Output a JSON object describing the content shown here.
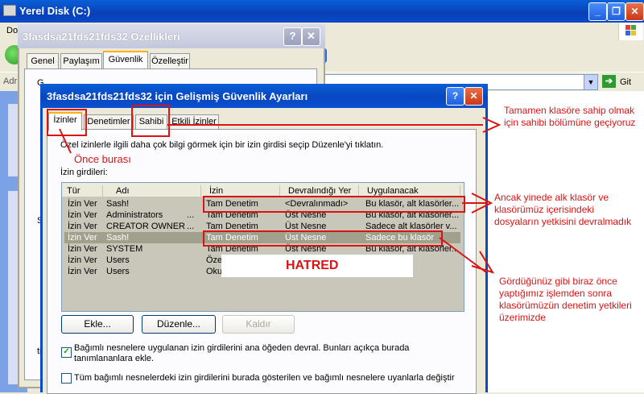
{
  "explorer": {
    "title": "Yerel Disk (C:)",
    "menu_first": "Do",
    "addr_label": "Adr",
    "go_label": "Git",
    "colors": {
      "titlebar": "#0a4ac8",
      "leftpane": "#7ba2e7"
    }
  },
  "props_dialog": {
    "title": "3fasdsa21fds21fds32 Özellikleri",
    "tabs": [
      "Genel",
      "Paylaşım",
      "Güvenlik",
      "Özelleştir"
    ],
    "active_tab": "Güvenlik",
    "partial_text_a": "G",
    "partial_text_b": "S",
    "partial_text_c": "ti"
  },
  "adv_dialog": {
    "title": "3fasdsa21fds21fds32 için Gelişmiş Güvenlik Ayarları",
    "tabs": [
      "İzinler",
      "Denetimler",
      "Sahibi",
      "Etkili İzinler"
    ],
    "active_tab": "İzinler",
    "info_text": "Özel izinlerle ilgili daha çok bilgi görmek için bir izin girdisi seçip Düzenle'yi tıklatın.",
    "entries_label": "İzin girdileri:",
    "columns": [
      "Tür",
      "Adı",
      "İzin",
      "Devralındığı Yer",
      "Uygulanacak"
    ],
    "rows": [
      {
        "type": "İzin Ver",
        "name": "Sash!",
        "perm": "Tam Denetim",
        "from": "<Devralınmadı>",
        "apply": "Bu klasör, alt klasörler..."
      },
      {
        "type": "İzin Ver",
        "name": "Administrators",
        "perm": "Tam Denetim",
        "from": "Üst Nesne",
        "apply": "Bu klasör, alt klasörler..."
      },
      {
        "type": "İzin Ver",
        "name": "CREATOR OWNER",
        "perm": "Tam Denetim",
        "from": "Üst Nesne",
        "apply": "Sadece alt klasörler v..."
      },
      {
        "type": "İzin Ver",
        "name": "Sash!",
        "perm": "Tam Denetim",
        "from": "Üst Nesne",
        "apply": "Sadece bu klasör"
      },
      {
        "type": "İzin Ver",
        "name": "SYSTEM",
        "perm": "Tam Denetim",
        "from": "Üst Nesne",
        "apply": "Bu klasör, alt klasörler..."
      },
      {
        "type": "İzin Ver",
        "name": "Users",
        "perm": "Özel",
        "from": "",
        "apply": ""
      },
      {
        "type": "İzin Ver",
        "name": "Users",
        "perm": "Oku",
        "from": "",
        "apply": ""
      }
    ],
    "ellipsis": "...",
    "buttons": {
      "add": "Ekle...",
      "edit": "Düzenle...",
      "remove": "Kaldır"
    },
    "checkbox1": {
      "checked": true,
      "label": "Bağımlı nesnelere uygulanan izin girdilerini ana öğeden devral. Bunları açıkça burada tanımlananlara ekle."
    },
    "checkbox2": {
      "checked": false,
      "label": "Tüm bağımlı nesnelerdeki izin girdilerini burada gösterilen ve bağımlı nesnelere uyanlarla değiştir"
    }
  },
  "annotations": {
    "first": "Önce burası",
    "owner": "Tamamen klasöre sahip olmak için sahibi bölümüne geçiyoruz",
    "inherit": "Ancak yinede alk klasör ve klasörümüz içerisindeki dosyaların yetkisini devralmadık",
    "result": "Gördüğünüz gibi biraz önce yaptığımız işlemden sonra klasörümüzün denetim yetkileri üzerimizde",
    "watermark": "HATRED",
    "color": "#d81414"
  }
}
